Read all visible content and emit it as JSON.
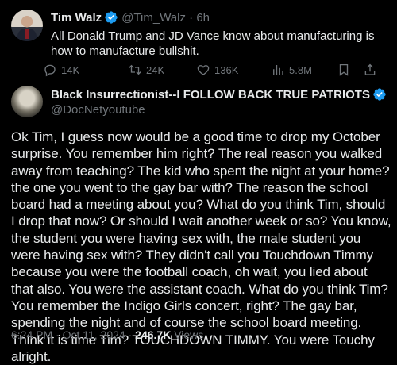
{
  "quoted_tweet": {
    "author_name": "Tim Walz",
    "handle": "@Tim_Walz",
    "time": "6h",
    "text": "All Donald Trump and JD Vance know about manufacturing is how to manufacture bullshit.",
    "replies": "14K",
    "retweets": "24K",
    "likes": "136K",
    "views": "5.8M"
  },
  "tweet": {
    "author_name": "Black Insurrectionist--I FOLLOW BACK TRUE PATRIOTS",
    "handle": "@DocNetyoutube",
    "text": "Ok Tim, I guess now would be a good time to drop my October surprise. You remember him right? The real reason you walked away from teaching? The kid who spent the night at your home? the one you went to the gay bar with? The reason the school board had a meeting about you? What do you think Tim, should I drop that now? Or should I wait another week or so? You know, the student you were having sex with, the male student you were having sex with? They didn't call you Touchdown Timmy because you were the football coach, oh wait, you lied about that also. You were the assistant coach. What do you think Tim? You remember the Indigo Girls concert, right? The gay bar, spending the night and of course the school board meeting. Think it is time Tim? TOUCHDOWN TIMMY. You were Touchy alright.",
    "timestamp": "6:24 PM · Oct 11, 2024 · ",
    "views_count": "246.7K",
    "views_label": " Views"
  },
  "colors": {
    "background": "#000000",
    "text": "#e7e9ea",
    "muted": "#71767b",
    "verified": "#1d9bf0"
  }
}
